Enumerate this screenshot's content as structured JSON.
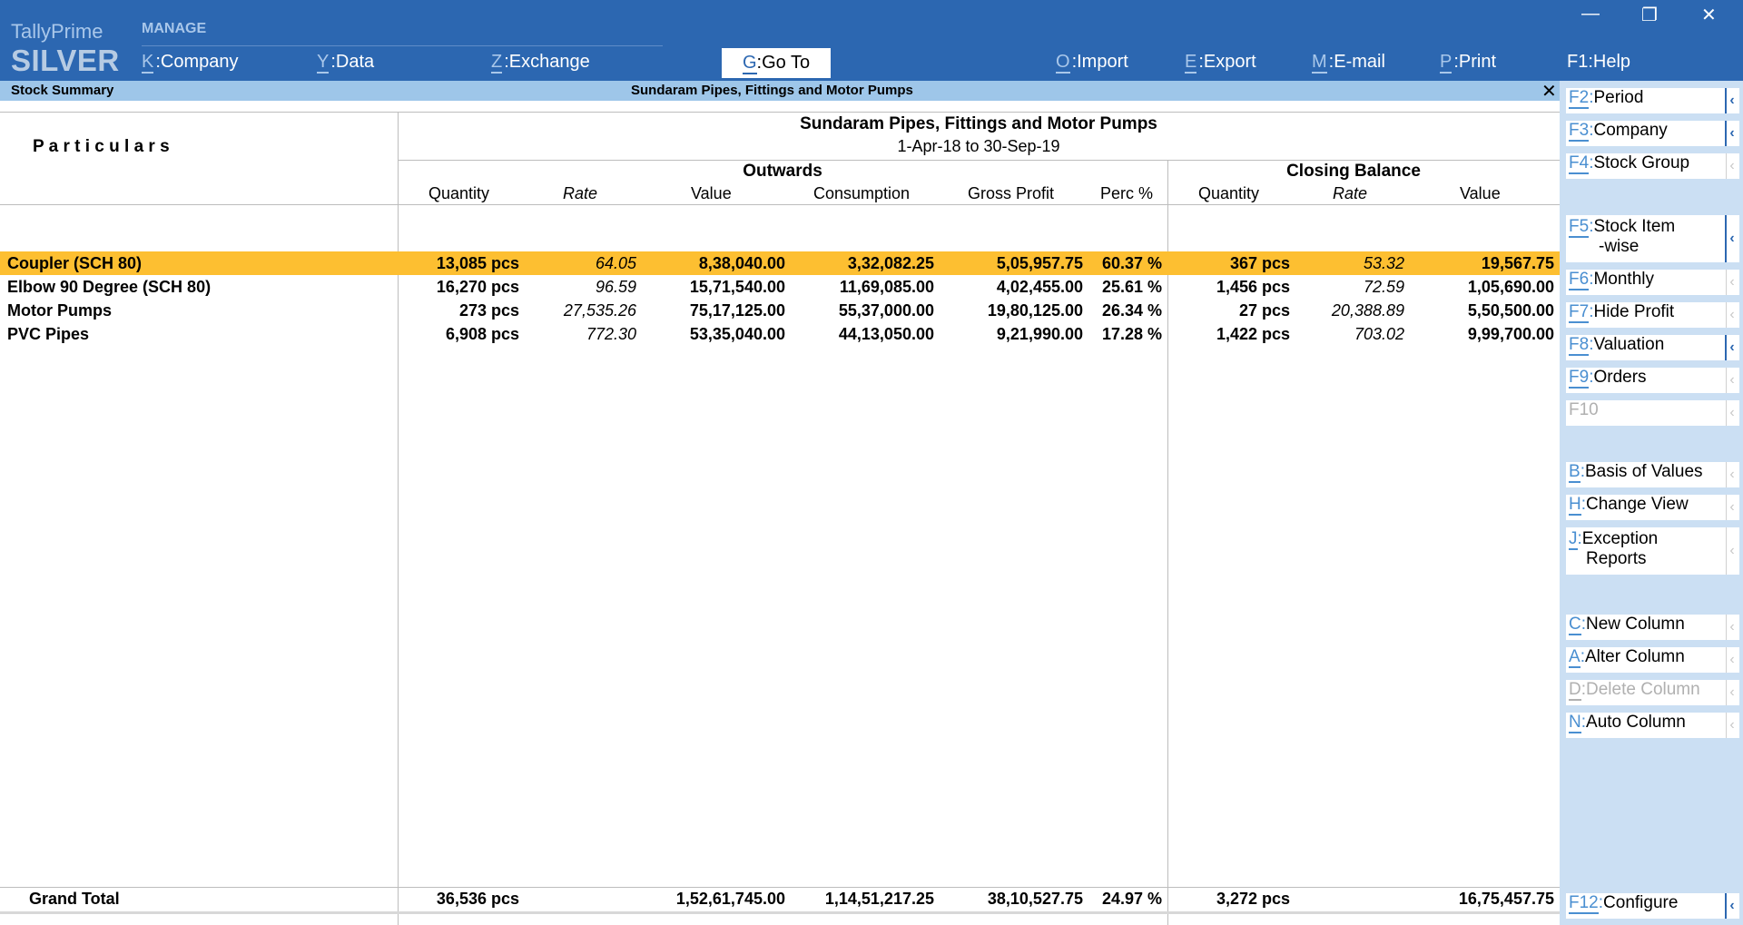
{
  "app": {
    "brand_top": "TallyPrime",
    "brand_bottom": "SILVER",
    "manage_label": "MANAGE"
  },
  "window": {
    "minimize": "—",
    "restore": "❐",
    "close": "✕"
  },
  "topmenu": [
    {
      "key": "K",
      "label": "Company"
    },
    {
      "key": "Y",
      "label": "Data"
    },
    {
      "key": "Z",
      "label": "Exchange"
    },
    {
      "key": "G",
      "label": "Go To"
    },
    {
      "key": "O",
      "label": "Import"
    },
    {
      "key": "E",
      "label": "Export"
    },
    {
      "key": "M",
      "label": "E-mail"
    },
    {
      "key": "P",
      "label": "Print"
    },
    {
      "key": "F1",
      "label": "Help"
    }
  ],
  "titlebar": {
    "left": "Stock Summary",
    "center": "Sundaram Pipes, Fittings and Motor Pumps",
    "close": "✕"
  },
  "report": {
    "company": "Sundaram Pipes, Fittings and Motor Pumps",
    "period": "1-Apr-18 to 30-Sep-19",
    "particulars_header": "P a r t i c u l a r s",
    "group_outwards": "Outwards",
    "group_closing": "Closing Balance",
    "col_headers": {
      "quantity": "Quantity",
      "rate": "Rate",
      "value": "Value",
      "consumption": "Consumption",
      "gross_profit": "Gross Profit",
      "perc": "Perc %",
      "cb_quantity": "Quantity",
      "cb_rate": "Rate",
      "cb_value": "Value"
    },
    "rows": [
      {
        "name": "Coupler (SCH 80)",
        "qty": "13,085 pcs",
        "rate": "64.05",
        "value": "8,38,040.00",
        "consumption": "3,32,082.25",
        "gp": "5,05,957.75",
        "perc": "60.37 %",
        "cb_qty": "367 pcs",
        "cb_rate": "53.32",
        "cb_value": "19,567.75",
        "selected": true
      },
      {
        "name": "Elbow 90 Degree (SCH 80)",
        "qty": "16,270 pcs",
        "rate": "96.59",
        "value": "15,71,540.00",
        "consumption": "11,69,085.00",
        "gp": "4,02,455.00",
        "perc": "25.61 %",
        "cb_qty": "1,456 pcs",
        "cb_rate": "72.59",
        "cb_value": "1,05,690.00"
      },
      {
        "name": "Motor Pumps",
        "qty": "273 pcs",
        "rate": "27,535.26",
        "value": "75,17,125.00",
        "consumption": "55,37,000.00",
        "gp": "19,80,125.00",
        "perc": "26.34 %",
        "cb_qty": "27 pcs",
        "cb_rate": "20,388.89",
        "cb_value": "5,50,500.00"
      },
      {
        "name": "PVC Pipes",
        "qty": "6,908 pcs",
        "rate": "772.30",
        "value": "53,35,040.00",
        "consumption": "44,13,050.00",
        "gp": "9,21,990.00",
        "perc": "17.28 %",
        "cb_qty": "1,422 pcs",
        "cb_rate": "703.02",
        "cb_value": "9,99,700.00"
      }
    ],
    "total": {
      "label": "Grand Total",
      "qty": "36,536 pcs",
      "value": "1,52,61,745.00",
      "consumption": "1,14,51,217.25",
      "gp": "38,10,527.75",
      "perc": "24.97 %",
      "cb_qty": "3,272 pcs",
      "cb_value": "16,75,457.75"
    }
  },
  "rightbar": [
    {
      "key": "F2",
      "label": "Period",
      "label2": "",
      "enabled": true,
      "strong": true
    },
    {
      "key": "F3",
      "label": "Company",
      "label2": "",
      "enabled": true,
      "strong": true
    },
    {
      "key": "F4",
      "label": "Stock Group",
      "label2": "",
      "enabled": true,
      "strong": false
    },
    {
      "key": "F5",
      "label": "Stock Item",
      "label2": "-wise",
      "enabled": true,
      "strong": true
    },
    {
      "key": "F6",
      "label": "Monthly",
      "label2": "",
      "enabled": true,
      "strong": false
    },
    {
      "key": "F7",
      "label": "Hide Profit",
      "label2": "",
      "enabled": true,
      "strong": false
    },
    {
      "key": "F8",
      "label": "Valuation",
      "label2": "",
      "enabled": true,
      "strong": true
    },
    {
      "key": "F9",
      "label": "Orders",
      "label2": "",
      "enabled": true,
      "strong": false
    },
    {
      "key": "F10",
      "label": "",
      "label2": "",
      "enabled": false,
      "strong": false
    },
    {
      "key": "B",
      "label": "Basis of Values",
      "label2": "",
      "enabled": true,
      "strong": false
    },
    {
      "key": "H",
      "label": "Change View",
      "label2": "",
      "enabled": true,
      "strong": false
    },
    {
      "key": "J",
      "label": "Exception",
      "label2": "Reports",
      "enabled": true,
      "strong": false
    },
    {
      "key": "C",
      "label": "New Column",
      "label2": "",
      "enabled": true,
      "strong": false
    },
    {
      "key": "A",
      "label": "Alter Column",
      "label2": "",
      "enabled": true,
      "strong": false
    },
    {
      "key": "D",
      "label": "Delete Column",
      "label2": "",
      "enabled": false,
      "strong": false
    },
    {
      "key": "N",
      "label": "Auto Column",
      "label2": "",
      "enabled": true,
      "strong": false
    },
    {
      "key": "F12",
      "label": "Configure",
      "label2": "",
      "enabled": true,
      "strong": true
    }
  ],
  "chevron": "‹"
}
